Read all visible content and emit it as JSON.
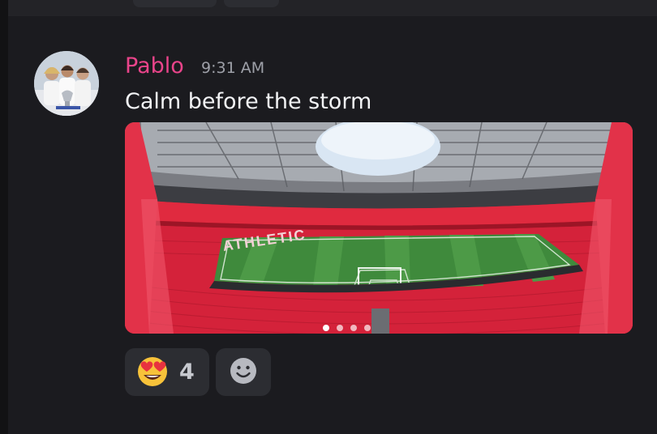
{
  "message": {
    "author": "Pablo",
    "timestamp": "9:31 AM",
    "text": "Calm before the storm",
    "attachment": {
      "stadium_banner_text": "ATHLETIC",
      "carousel_dots": 4,
      "active_dot": 0
    },
    "reactions": [
      {
        "emoji": "heart-eyes-emoji",
        "count": "4"
      }
    ],
    "add_reaction_icon": "smiley-icon"
  },
  "colors": {
    "author": "#e9448a",
    "background": "#1b1b1f",
    "reaction_bg": "#2c2d32",
    "seats": "#d8203a"
  }
}
